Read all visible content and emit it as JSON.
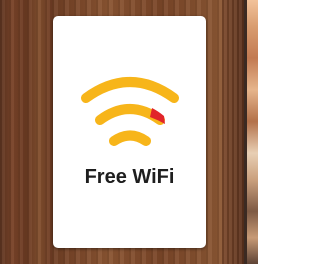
{
  "sign": {
    "text": "Free WiFi",
    "icon": "wifi-icon"
  },
  "colors": {
    "wifi_arcs": "#f7b51a",
    "wifi_accent": "#e1252a",
    "sign_background": "#ffffff",
    "text": "#1e1e1e",
    "wood": "#7a4628"
  }
}
